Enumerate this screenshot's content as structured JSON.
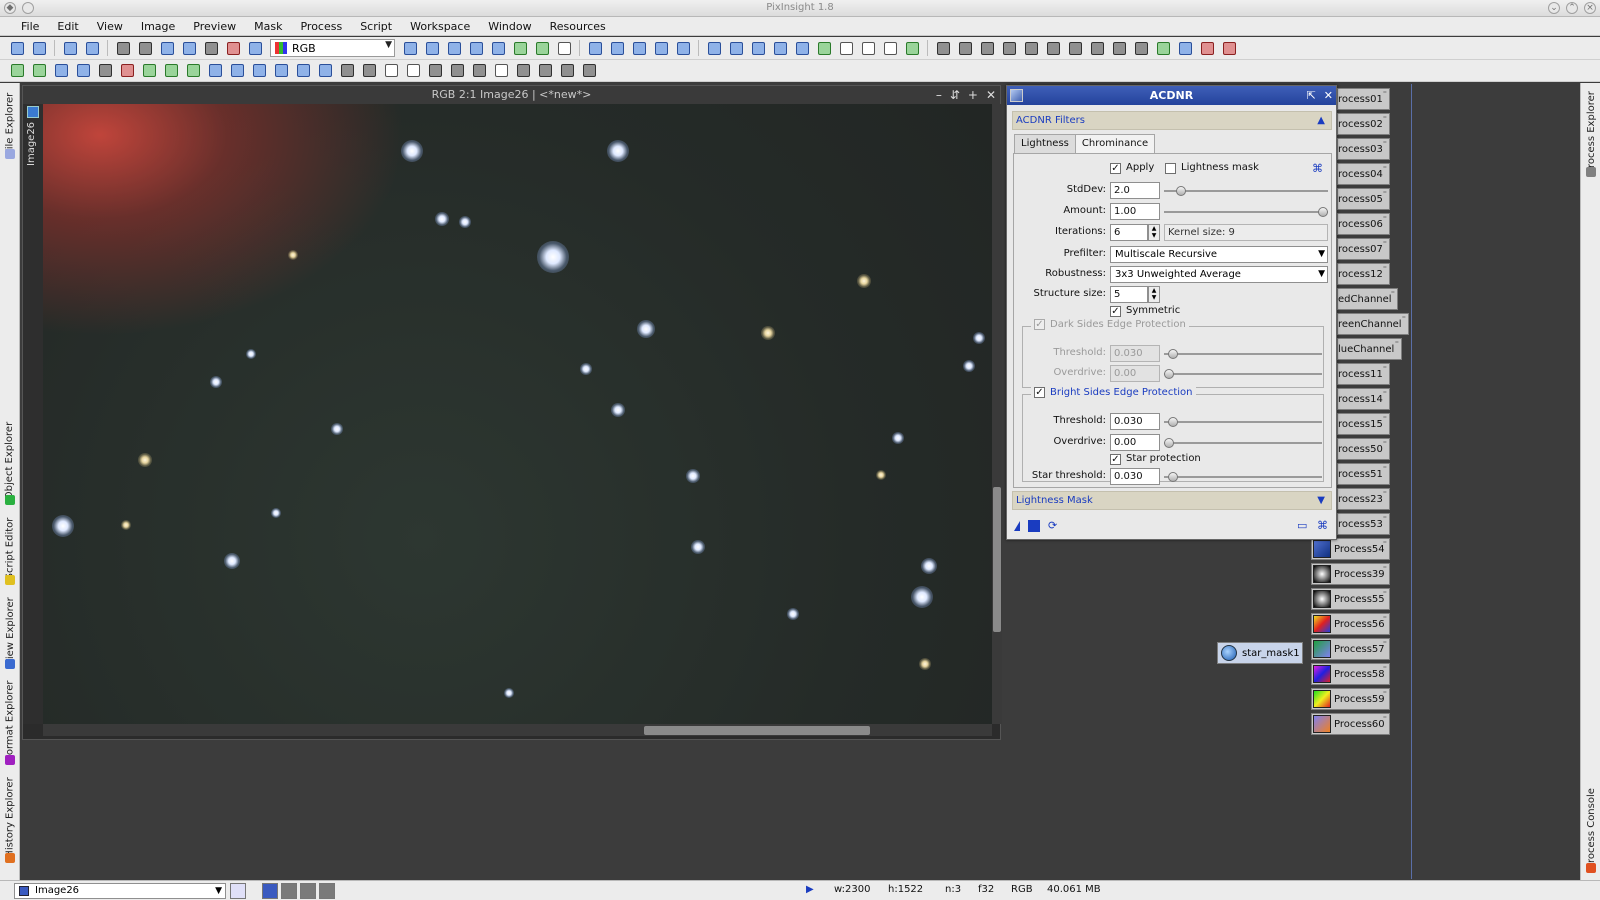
{
  "app": {
    "title": "PixInsight 1.8"
  },
  "menu": [
    "File",
    "Edit",
    "View",
    "Image",
    "Preview",
    "Mask",
    "Process",
    "Script",
    "Workspace",
    "Window",
    "Resources"
  ],
  "toolbar": {
    "channel_select": "RGB"
  },
  "left_dock": [
    "File Explorer",
    "Object Explorer",
    "Script Editor",
    "View Explorer",
    "Format Explorer",
    "History Explorer"
  ],
  "right_dock": [
    "Process Explorer",
    "Process Console"
  ],
  "image_window": {
    "title": "RGB 2:1 Image26 | <*new*>",
    "tab_label": "Image26"
  },
  "acdnr": {
    "title": "ACDNR",
    "filters_header": "ACDNR Filters",
    "tabs": [
      "Lightness",
      "Chrominance"
    ],
    "apply_label": "Apply",
    "lightness_mask_label": "Lightness mask",
    "stddev_label": "StdDev:",
    "stddev": "2.0",
    "stddev_pos": 0.08,
    "amount_label": "Amount:",
    "amount": "1.00",
    "amount_pos": 1.0,
    "iterations_label": "Iterations:",
    "iterations": "6",
    "kernel_size": "Kernel size: 9",
    "prefilter_label": "Prefilter:",
    "prefilter": "Multiscale Recursive",
    "robustness_label": "Robustness:",
    "robustness": "3x3 Unweighted Average",
    "structure_size_label": "Structure size:",
    "structure_size": "5",
    "symmetric_label": "Symmetric",
    "dark_sides": {
      "label": "Dark Sides Edge Protection",
      "threshold_label": "Threshold:",
      "threshold": "0.030",
      "threshold_pos": 0.03,
      "overdrive_label": "Overdrive:",
      "overdrive": "0.00",
      "overdrive_pos": 0.0
    },
    "bright_sides": {
      "label": "Bright Sides Edge Protection",
      "threshold_label": "Threshold:",
      "threshold": "0.030",
      "threshold_pos": 0.03,
      "overdrive_label": "Overdrive:",
      "overdrive": "0.00",
      "overdrive_pos": 0.0
    },
    "star_protection_label": "Star protection",
    "star_threshold_label": "Star threshold:",
    "star_threshold": "0.030",
    "star_threshold_pos": 0.03,
    "lightness_mask_header": "Lightness Mask"
  },
  "process_icons": [
    "rocess01",
    "rocess02",
    "rocess03",
    "rocess04",
    "rocess05",
    "rocess06",
    "rocess07",
    "rocess12",
    "edChannel",
    "reenChannel",
    "lueChannel",
    "rocess11",
    "rocess14",
    "rocess15",
    "rocess50",
    "rocess51",
    "rocess23",
    "rocess53",
    "Process54",
    "Process39",
    "Process55",
    "Process56",
    "Process57",
    "Process58",
    "Process59",
    "Process60"
  ],
  "star_mask_icon": "star_mask1",
  "status": {
    "view": "Image26",
    "width": "w:2300",
    "height": "h:1522",
    "channels": "n:3",
    "format": "f32",
    "color_space": "RGB",
    "size": "40.061 MB"
  }
}
